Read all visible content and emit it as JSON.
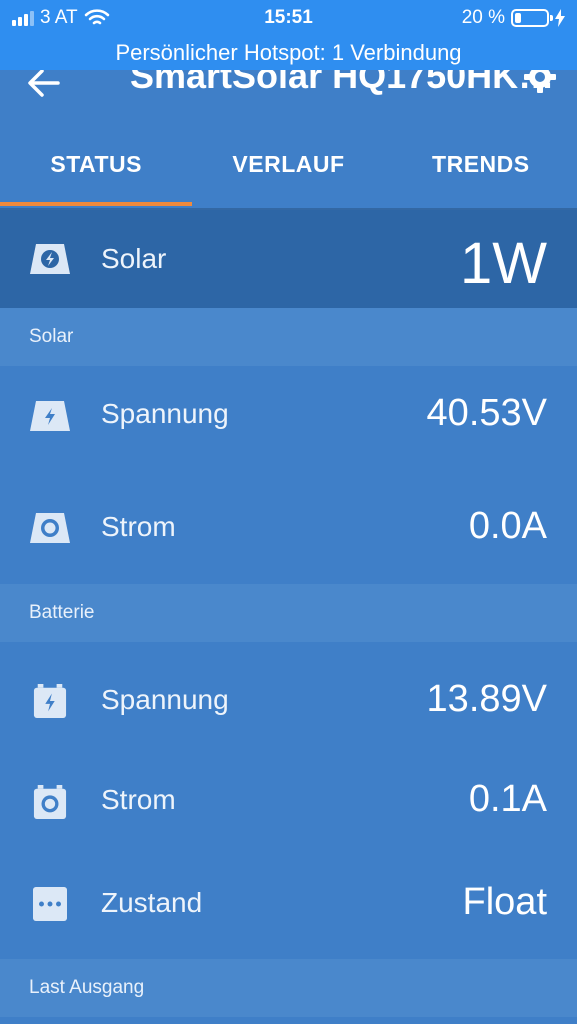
{
  "statusbar": {
    "carrier": "3 AT",
    "time": "15:51",
    "battery_percent": "20 %",
    "battery_level": 0.2
  },
  "hotspot": {
    "text": "Persönlicher Hotspot: 1 Verbindung"
  },
  "header": {
    "title": "SmartSolar HQ1750HK…",
    "tabs": [
      {
        "label": "STATUS",
        "active": true
      },
      {
        "label": "VERLAUF",
        "active": false
      },
      {
        "label": "TRENDS",
        "active": false
      }
    ]
  },
  "hero": {
    "label": "Solar",
    "value": "1W",
    "icon": "solar-panel-icon"
  },
  "sections": {
    "solar": {
      "title": "Solar",
      "items": [
        {
          "label": "Spannung",
          "value": "40.53V",
          "icon": "solar-voltage-icon"
        },
        {
          "label": "Strom",
          "value": "0.0A",
          "icon": "solar-current-icon"
        }
      ]
    },
    "battery": {
      "title": "Batterie",
      "items": [
        {
          "label": "Spannung",
          "value": "13.89V",
          "icon": "battery-voltage-icon"
        },
        {
          "label": "Strom",
          "value": "0.1A",
          "icon": "battery-current-icon"
        },
        {
          "label": "Zustand",
          "value": "Float",
          "icon": "state-dots-icon"
        }
      ]
    },
    "load": {
      "title": "Last Ausgang"
    }
  },
  "colors": {
    "statusbar": "#2f8ef0",
    "background": "#3f7fc8",
    "hero": "#2d66a6",
    "section": "#4a88cc",
    "accent": "#f08a3c"
  }
}
